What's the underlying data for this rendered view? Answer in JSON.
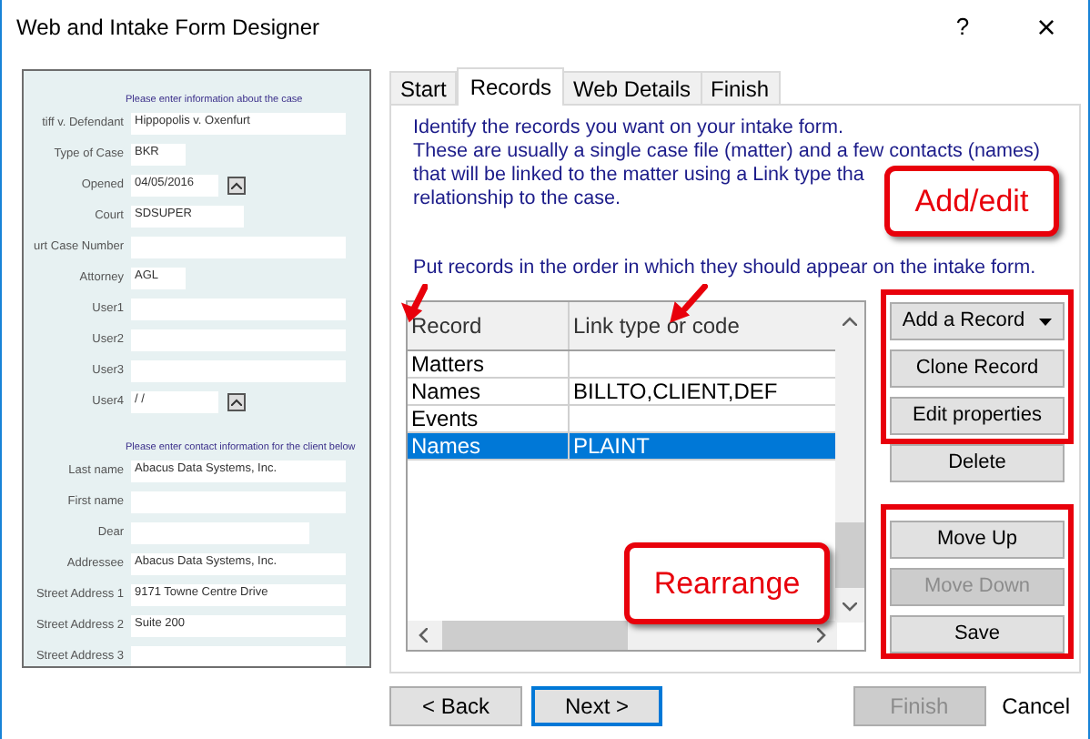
{
  "window": {
    "title": "Web and Intake Form Designer",
    "help": "?",
    "close": "×"
  },
  "form_preview": {
    "sections": [
      {
        "header": "Please enter information about the case",
        "fields": [
          {
            "label": "tiff v. Defendant",
            "value": "Hippopolis v. Oxenfurt",
            "kind": "wide"
          },
          {
            "label": "Type of Case",
            "value": "BKR",
            "kind": "narrow"
          },
          {
            "label": "Opened",
            "value": "04/05/2016",
            "kind": "date"
          },
          {
            "label": "Court",
            "value": "SDSUPER",
            "kind": "medium"
          },
          {
            "label": "urt Case Number",
            "kind": "wide"
          },
          {
            "label": "Attorney",
            "value": "AGL",
            "kind": "narrow"
          },
          {
            "label": "User1",
            "kind": "wide"
          },
          {
            "label": "User2",
            "kind": "wide"
          },
          {
            "label": "User3",
            "kind": "wide"
          },
          {
            "label": "User4",
            "value": " /  /",
            "kind": "date"
          }
        ]
      },
      {
        "header": "Please enter contact information for the client below",
        "fields": [
          {
            "label": "Last name",
            "value": "Abacus Data Systems, Inc.",
            "kind": "wide"
          },
          {
            "label": "First name",
            "kind": "wide"
          },
          {
            "label": "Dear",
            "kind": "long"
          },
          {
            "label": "Addressee",
            "value": "Abacus Data Systems, Inc.",
            "kind": "wide"
          },
          {
            "label": "Street Address 1",
            "value": "9171 Towne Centre Drive",
            "kind": "wide"
          },
          {
            "label": "Street Address 2",
            "value": "Suite 200",
            "kind": "wide"
          },
          {
            "label": "Street Address 3",
            "kind": "wide"
          }
        ]
      }
    ]
  },
  "tabs": [
    {
      "label": "Start",
      "selected": false
    },
    {
      "label": "Records",
      "selected": true
    },
    {
      "label": "Web Details",
      "selected": false
    },
    {
      "label": "Finish",
      "selected": false
    }
  ],
  "instructions": [
    "Identify the records you want on your intake form.",
    "These are usually a single case file (matter) and a few contacts (names)",
    "that will be linked to the matter using a Link type tha",
    "relationship to the case."
  ],
  "order_hint": "Put records in the order in which they should appear on the intake form.",
  "table": {
    "columns": [
      "Record",
      "Link type or code"
    ],
    "rows": [
      {
        "cells": [
          "Matters",
          ""
        ],
        "selected": false
      },
      {
        "cells": [
          "Names",
          "BILLTO,CLIENT,DEF"
        ],
        "selected": false
      },
      {
        "cells": [
          "Events",
          ""
        ],
        "selected": false
      },
      {
        "cells": [
          "Names",
          "PLAINT"
        ],
        "selected": true
      }
    ]
  },
  "record_buttons": [
    {
      "label": "Add a Record",
      "kind": "dropdown",
      "disabled": false
    },
    {
      "label": "Clone Record",
      "kind": "plain",
      "disabled": false
    },
    {
      "label": "Edit properties",
      "kind": "plain",
      "disabled": false
    },
    {
      "label": "Delete",
      "kind": "plain",
      "disabled": false
    },
    {
      "label": "Move Up",
      "kind": "plain",
      "disabled": false
    },
    {
      "label": "Move Down",
      "kind": "plain",
      "disabled": true
    },
    {
      "label": "Save",
      "kind": "plain",
      "disabled": false
    }
  ],
  "callouts": [
    "Add/edit",
    "Rearrange"
  ],
  "footer_buttons": [
    {
      "label": "< Back",
      "kind": "plain",
      "disabled": false
    },
    {
      "label": "Next >",
      "kind": "default",
      "disabled": false
    },
    {
      "label": "Finish",
      "kind": "plain",
      "disabled": true
    },
    {
      "label": "Cancel",
      "kind": "link",
      "disabled": false
    }
  ]
}
